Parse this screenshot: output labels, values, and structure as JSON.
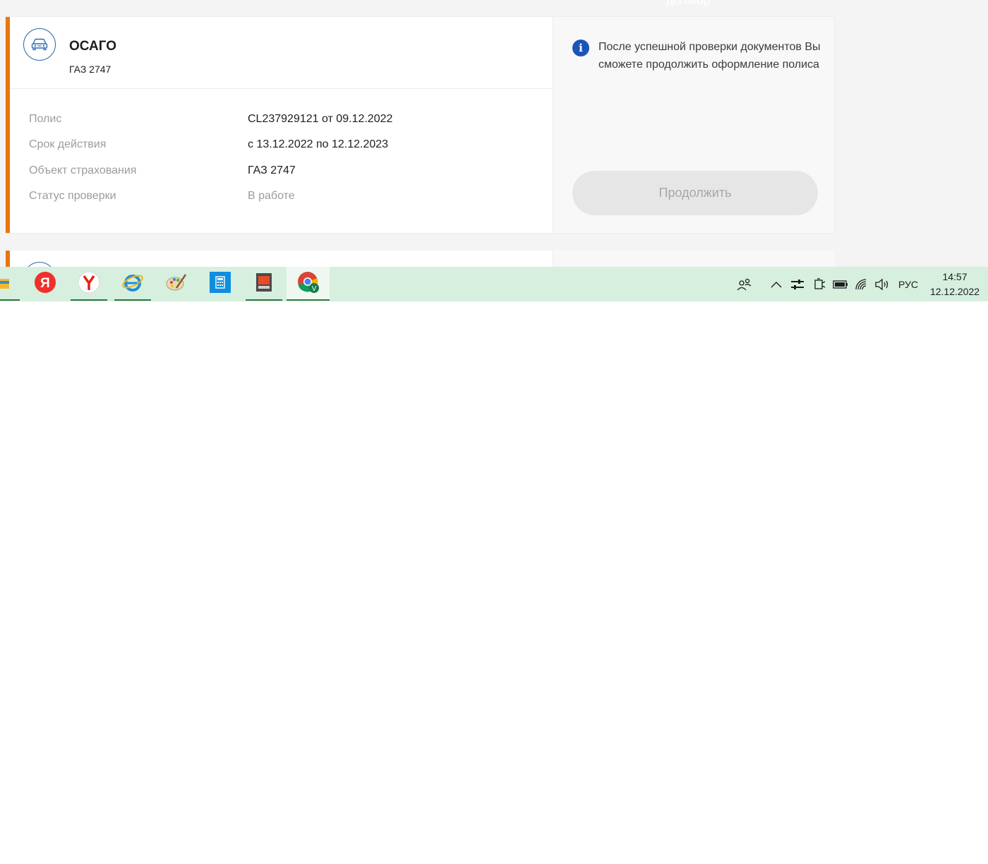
{
  "header": {
    "ghost_text": "договор"
  },
  "policy_card": {
    "title": "ОСАГО",
    "subtitle": "ГАЗ 2747",
    "icon": "car-icon",
    "accent_color": "#e8760f",
    "rows": [
      {
        "label": "Полис",
        "value": "CL237929121 от 09.12.2022"
      },
      {
        "label": "Срок действия",
        "value": "с 13.12.2022 по 12.12.2023"
      },
      {
        "label": "Объект страхования",
        "value": "ГАЗ 2747"
      },
      {
        "label": "Статус проверки",
        "value": "В работе"
      }
    ],
    "info_text": "После успешной проверки документов Вы сможете продолжить оформление полиса",
    "continue_label": "Продолжить"
  },
  "taskbar": {
    "apps": [
      {
        "name": "file-explorer",
        "icon": "folder-icon"
      },
      {
        "name": "yandex",
        "icon": "yandex-icon"
      },
      {
        "name": "yandex-browser",
        "icon": "yandex-browser-icon"
      },
      {
        "name": "internet-explorer",
        "icon": "ie-icon"
      },
      {
        "name": "paint",
        "icon": "paint-icon"
      },
      {
        "name": "calculator",
        "icon": "calculator-icon"
      },
      {
        "name": "scanner",
        "icon": "scanner-icon"
      },
      {
        "name": "chrome",
        "icon": "chrome-icon"
      }
    ],
    "tray": {
      "language": "РУС",
      "time": "14:57",
      "date": "12.12.2022"
    }
  }
}
